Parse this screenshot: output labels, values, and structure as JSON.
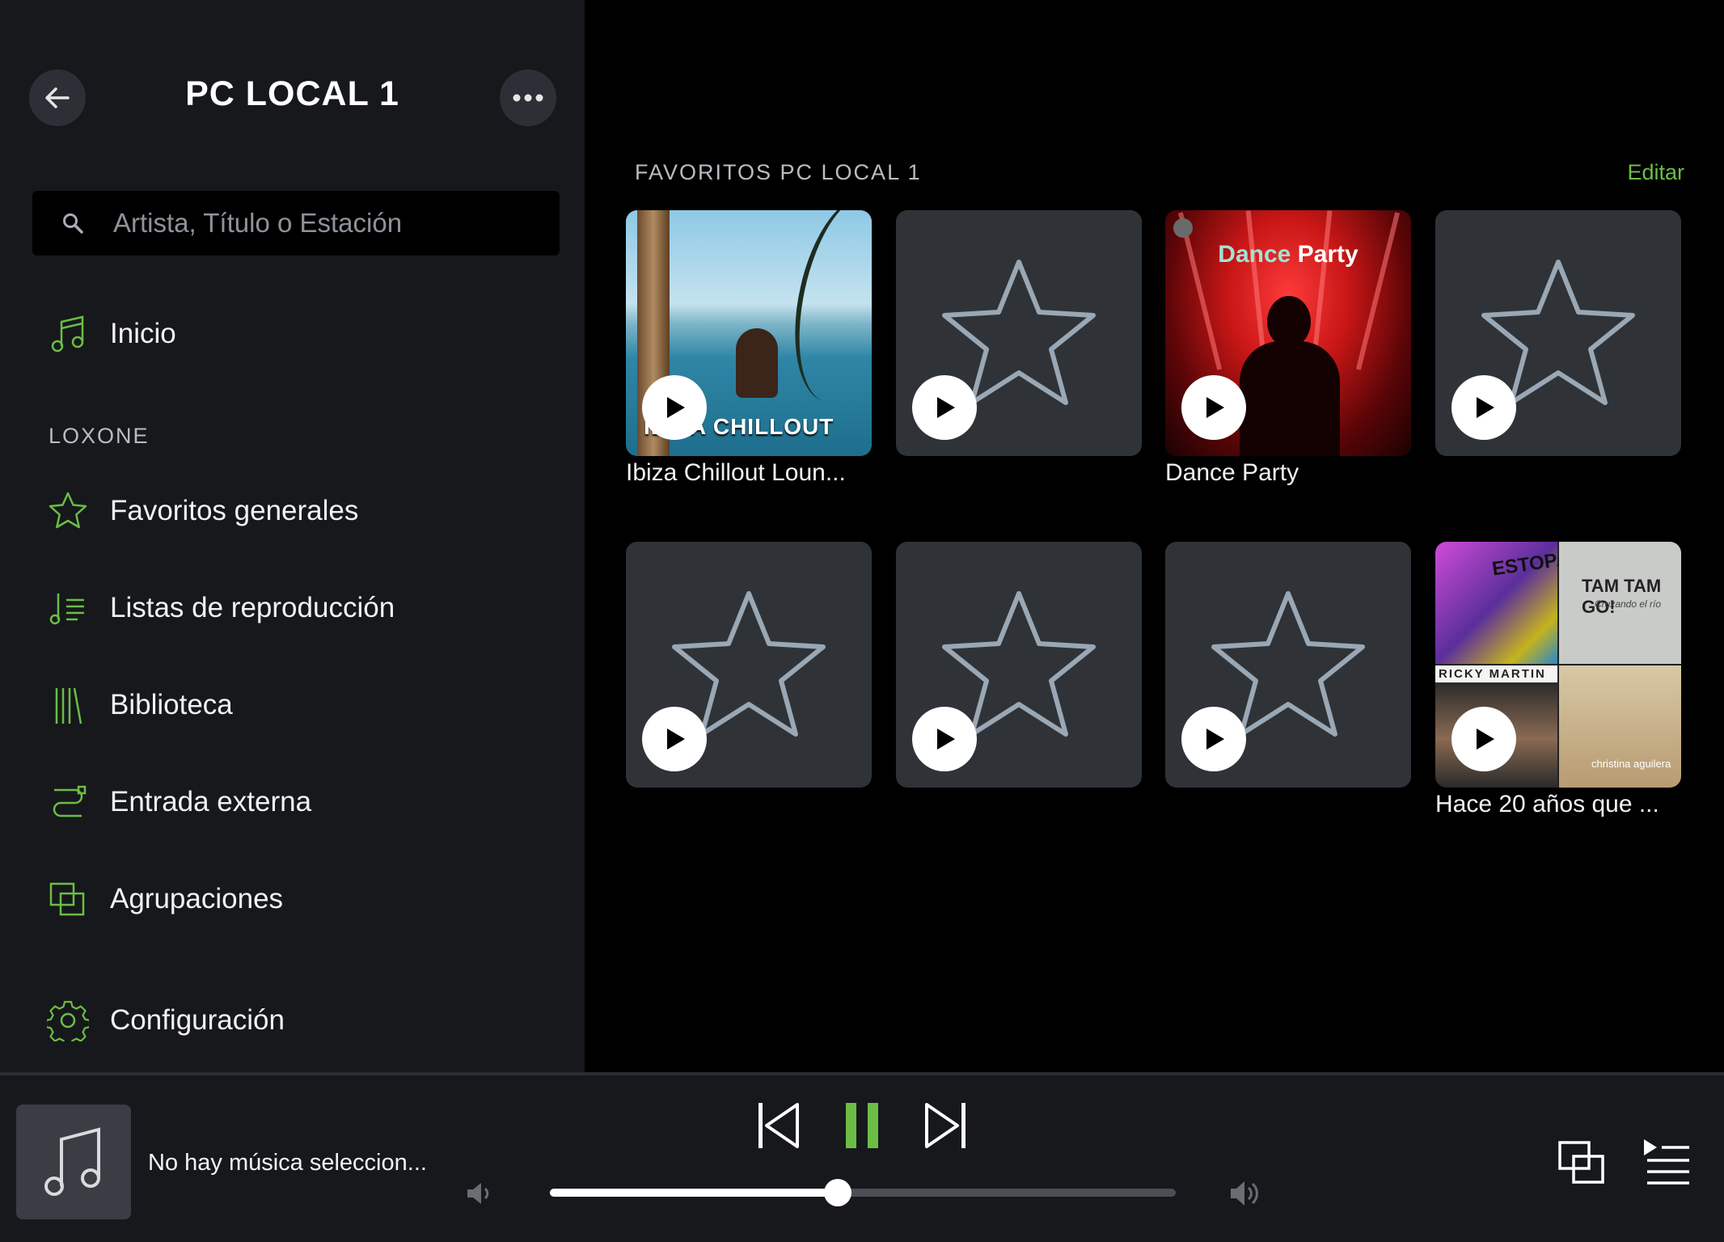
{
  "sidebar": {
    "title": "PC LOCAL 1",
    "search_placeholder": "Artista, Título o Estación",
    "home_label": "Inicio",
    "section_label": "LOXONE",
    "items": [
      {
        "label": "Favoritos generales",
        "icon": "star-icon"
      },
      {
        "label": "Listas de reproducción",
        "icon": "playlist-icon"
      },
      {
        "label": "Biblioteca",
        "icon": "library-icon"
      },
      {
        "label": "Entrada externa",
        "icon": "line-in-icon"
      },
      {
        "label": "Agrupaciones",
        "icon": "groups-icon"
      }
    ],
    "settings_label": "Configuración"
  },
  "main": {
    "heading": "FAVORITOS PC LOCAL 1",
    "edit_label": "Editar",
    "tiles": [
      {
        "caption": "Ibiza Chillout Loun...",
        "art_text": "IBIZA CHILLOUT"
      },
      {
        "caption": ""
      },
      {
        "caption": "Dance Party",
        "art_text_a": "Dance",
        "art_text_b": "Party"
      },
      {
        "caption": ""
      },
      {
        "caption": ""
      },
      {
        "caption": ""
      },
      {
        "caption": ""
      },
      {
        "caption": "Hace 20 años que ...",
        "art_texts": [
          "ESTOPA",
          "TAM TAM GO!",
          "Cruzando el río",
          "RICKY MARTIN",
          "christina aguilera"
        ]
      }
    ]
  },
  "player": {
    "title": "No hay música seleccion...",
    "progress": 0.46
  },
  "colors": {
    "accent": "#6cbd45",
    "sidebar_bg": "#16181c",
    "tile_bg": "#2f3338"
  }
}
